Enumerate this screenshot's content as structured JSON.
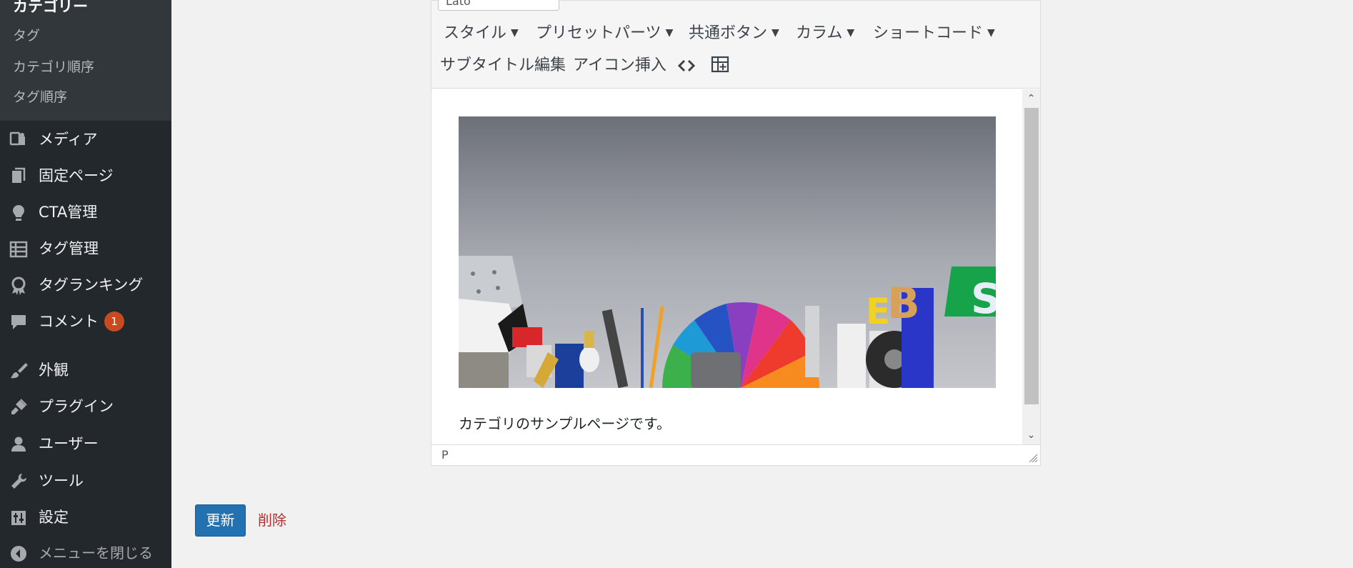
{
  "sidebar": {
    "submenu": {
      "title": "カテゴリー",
      "items": [
        "タグ",
        "カテゴリ順序",
        "タグ順序"
      ]
    },
    "menu": [
      {
        "label": "メディア",
        "icon": "media-icon"
      },
      {
        "label": "固定ページ",
        "icon": "pages-icon"
      },
      {
        "label": "CTA管理",
        "icon": "lightbulb-icon"
      },
      {
        "label": "タグ管理",
        "icon": "list-icon"
      },
      {
        "label": "タグランキング",
        "icon": "award-icon"
      },
      {
        "label": "コメント",
        "icon": "comment-icon",
        "badge": "1"
      },
      {
        "label": "外観",
        "icon": "appearance-brush-icon"
      },
      {
        "label": "プラグイン",
        "icon": "plugin-icon"
      },
      {
        "label": "ユーザー",
        "icon": "user-icon"
      },
      {
        "label": "ツール",
        "icon": "wrench-icon"
      },
      {
        "label": "設定",
        "icon": "settings-sliders-icon"
      }
    ],
    "collapse_label": "メニューを閉じる",
    "colors": {
      "bg": "#23282d",
      "submenu_bg": "#32373c",
      "badge": "#ca4a1f"
    }
  },
  "editor": {
    "format_select": "Lato",
    "toolbar_row1": [
      "スタイル",
      "プリセットパーツ",
      "共通ボタン",
      "カラム",
      "ショートコード"
    ],
    "toolbar_row2": [
      "サブタイトル編集",
      "アイコン挿入"
    ],
    "toolbar_icons": [
      "code-icon",
      "table-insert-icon"
    ],
    "body_text": "カテゴリのサンプルページです。",
    "path": "P"
  },
  "actions": {
    "update_label": "更新",
    "delete_label": "削除",
    "colors": {
      "primary": "#2271b1",
      "delete": "#b32d2e"
    }
  }
}
